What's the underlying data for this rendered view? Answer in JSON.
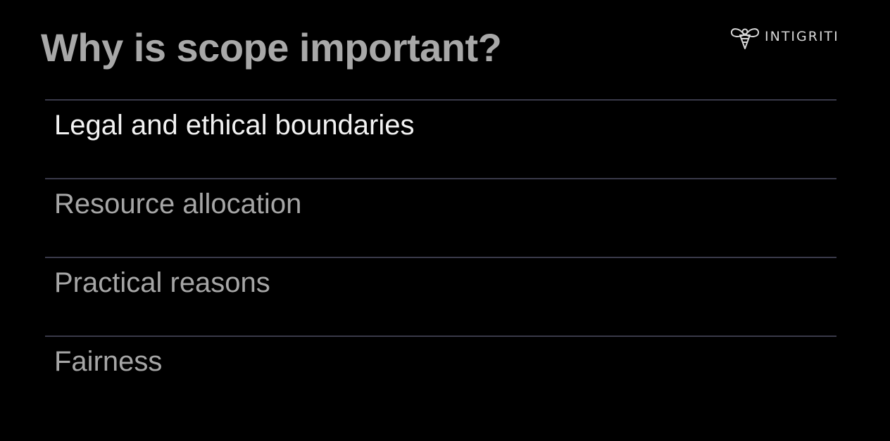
{
  "slide": {
    "title": "Why is scope important?",
    "logo_text": "INTIGRITI",
    "logo_icon": "bee-icon",
    "items": [
      {
        "label": "Legal and ethical boundaries",
        "active": true
      },
      {
        "label": "Resource allocation",
        "active": false
      },
      {
        "label": "Practical reasons",
        "active": false
      },
      {
        "label": "Fairness",
        "active": false
      }
    ],
    "colors": {
      "background": "#000000",
      "title": "#a8a8a8",
      "active_item": "#f2f2f2",
      "inactive_item": "#a6a6a6",
      "divider": "#3a3a4a"
    }
  }
}
